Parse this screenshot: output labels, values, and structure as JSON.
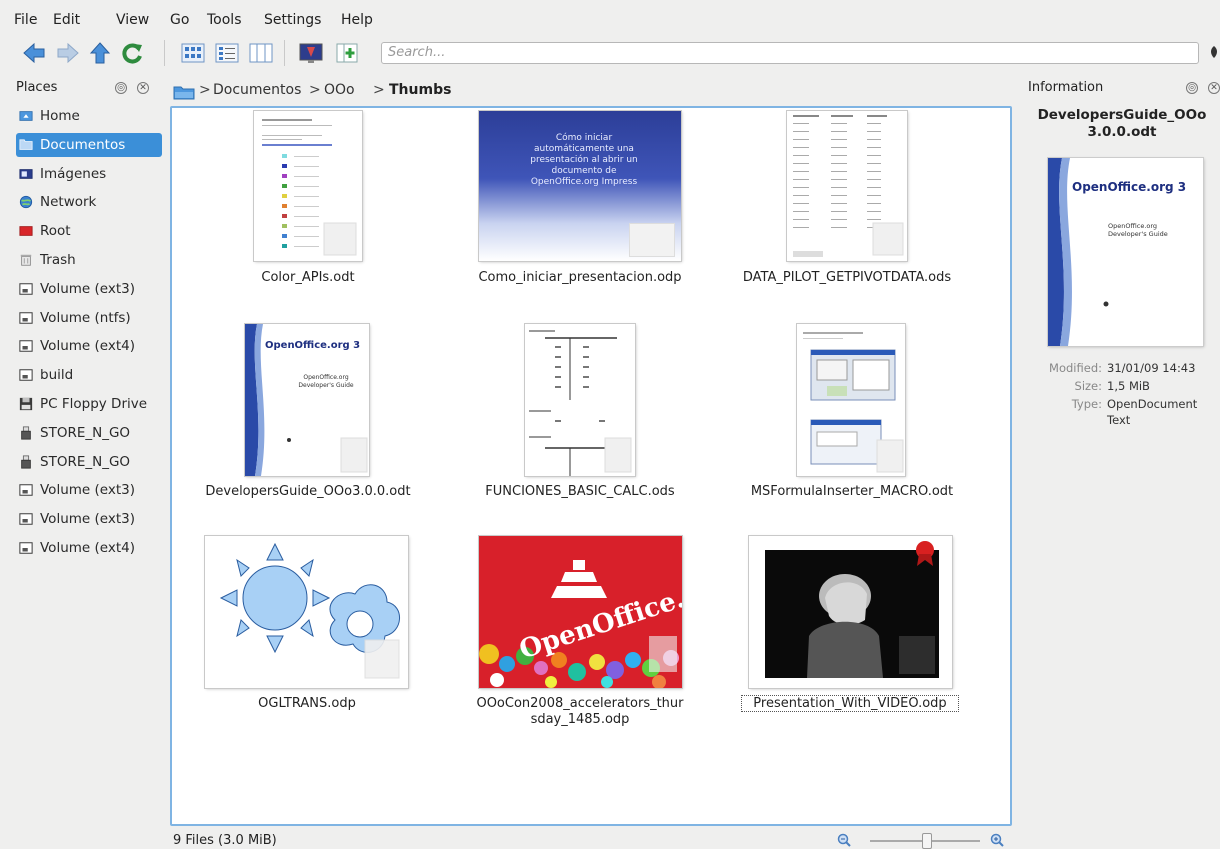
{
  "menu": [
    "File",
    "Edit",
    "View",
    "Go",
    "Tools",
    "Settings",
    "Help"
  ],
  "toolbar": {
    "search_placeholder": "Search...",
    "icons": [
      "back-icon",
      "forward-icon",
      "up-icon",
      "reload-icon",
      "icons-view-icon",
      "details-view-icon",
      "columns-view-icon",
      "preview-icon",
      "split-view-icon"
    ]
  },
  "places": {
    "title": "Places",
    "items": [
      {
        "label": "Home",
        "icon": "home-folder-icon"
      },
      {
        "label": "Documentos",
        "icon": "folder-icon",
        "selected": true
      },
      {
        "label": "Imágenes",
        "icon": "image-folder-icon"
      },
      {
        "label": "Network",
        "icon": "network-icon"
      },
      {
        "label": "Root",
        "icon": "red-folder-icon"
      },
      {
        "label": "Trash",
        "icon": "trash-icon"
      },
      {
        "label": "Volume (ext3)",
        "icon": "drive-icon"
      },
      {
        "label": "Volume (ntfs)",
        "icon": "drive-icon"
      },
      {
        "label": "Volume (ext4)",
        "icon": "drive-icon"
      },
      {
        "label": "build",
        "icon": "drive-icon"
      },
      {
        "label": "PC Floppy Drive",
        "icon": "floppy-icon"
      },
      {
        "label": "STORE_N_GO",
        "icon": "usb-icon"
      },
      {
        "label": "STORE_N_GO",
        "icon": "usb-icon"
      },
      {
        "label": "Volume (ext3)",
        "icon": "drive-icon"
      },
      {
        "label": "Volume (ext3)",
        "icon": "drive-icon"
      },
      {
        "label": "Volume (ext4)",
        "icon": "drive-icon"
      }
    ]
  },
  "breadcrumb": {
    "parts": [
      "Documentos",
      "OOo"
    ],
    "current": "Thumbs",
    "sep": ">"
  },
  "files": [
    {
      "name": "Color_APIs.odt"
    },
    {
      "name": "Como_iniciar_presentacion.odp"
    },
    {
      "name": "DATA_PILOT_GETPIVOTDATA.ods"
    },
    {
      "name": "DevelopersGuide_OOo3.0.0.odt"
    },
    {
      "name": "FUNCIONES_BASIC_CALC.ods"
    },
    {
      "name": "MSFormulaInserter_MACRO.odt"
    },
    {
      "name": "OGLTRANS.odp"
    },
    {
      "name": "OOoCon2008_accelerators_thursday_1485.odp",
      "line1": "OOoCon2008_accelerators_thur",
      "line2": "sday_1485.odp"
    },
    {
      "name": "Presentation_With_VIDEO.odp"
    }
  ],
  "thumb_text": {
    "como_iniciar": "Cómo iniciar automáticamente una presentación al abrir un documento de OpenOffice.org Impress",
    "oo_logo": "OpenOffice.org 3",
    "oo_dev": "OpenOffice.org Developer's Guide",
    "ooocon_logo": "OpenOffice.org"
  },
  "status": {
    "text": "9 Files (3.0 MiB)"
  },
  "info": {
    "title": "Information",
    "filename_line1": "DevelopersGuide_OOo",
    "filename_line2": "3.0.0.odt",
    "modified_label": "Modified:",
    "modified_value": "31/01/09 14:43",
    "size_label": "Size:",
    "size_value": "1,5 MiB",
    "type_label": "Type:",
    "type_value_1": "OpenDocument",
    "type_value_2": "Text"
  },
  "colors": {
    "selection": "#3b8fd8",
    "view_border": "#7fb4e3",
    "background": "#efefee"
  }
}
